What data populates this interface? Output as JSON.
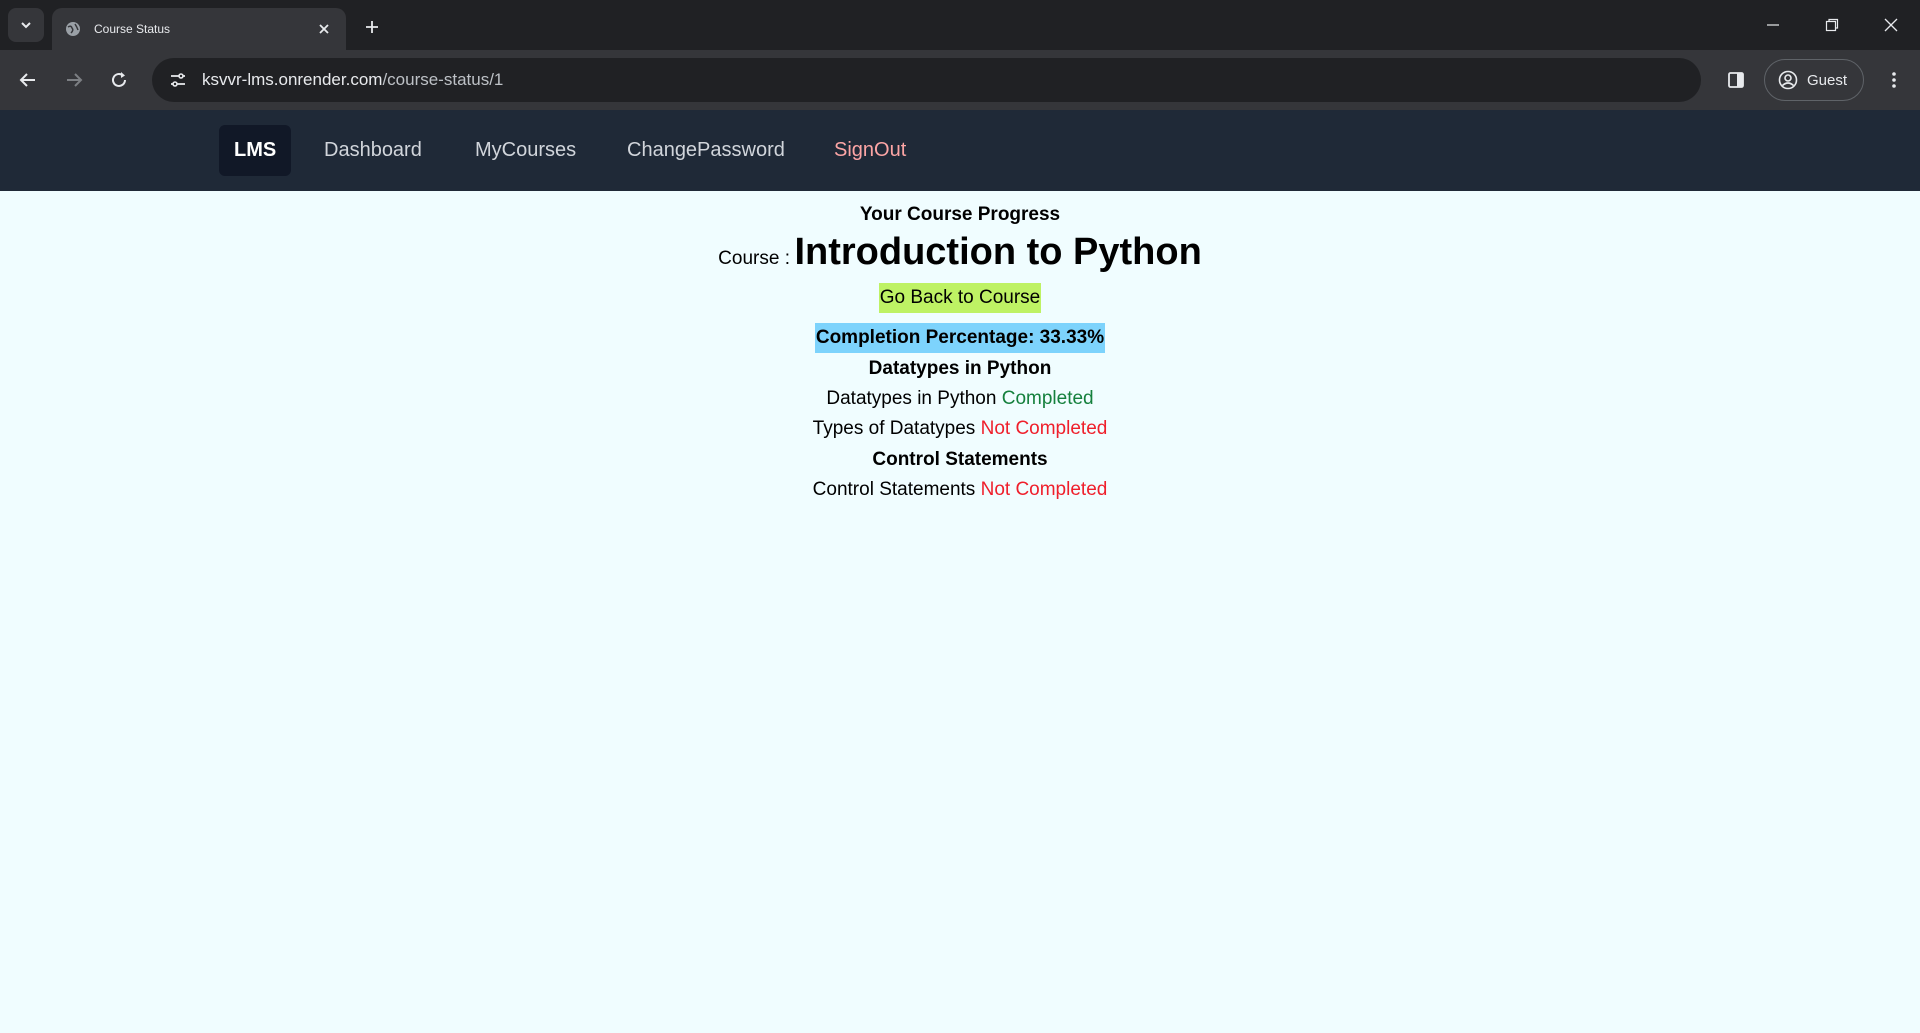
{
  "browser": {
    "tab_title": "Course Status",
    "url_host": "ksvvr-lms.onrender.com",
    "url_path": "/course-status/1",
    "profile_label": "Guest"
  },
  "nav": {
    "brand": "LMS",
    "links": [
      "Dashboard",
      "MyCourses",
      "ChangePassword",
      "SignOut"
    ]
  },
  "progress": {
    "heading": "Your Course Progress",
    "course_prefix": "Course :",
    "course_name": "Introduction to Python",
    "back_label": "Go Back to Course",
    "completion_label": "Completion Percentage: 33.33%",
    "chapters": [
      {
        "title": "Datatypes in Python",
        "pages": [
          {
            "title": "Datatypes in Python",
            "status": "Completed"
          },
          {
            "title": "Types of Datatypes",
            "status": "Not Completed"
          }
        ]
      },
      {
        "title": "Control Statements",
        "pages": [
          {
            "title": "Control Statements",
            "status": "Not Completed"
          }
        ]
      }
    ]
  },
  "colors": {
    "nav_bg": "#1f2937",
    "brand_bg": "#111827",
    "signout": "#fca5a5",
    "page_bg": "#f0fdff",
    "back_button": "#bef264",
    "completion_bg": "#7dd3fc",
    "completed": "#15803d",
    "not_completed": "#ef1f2b"
  }
}
